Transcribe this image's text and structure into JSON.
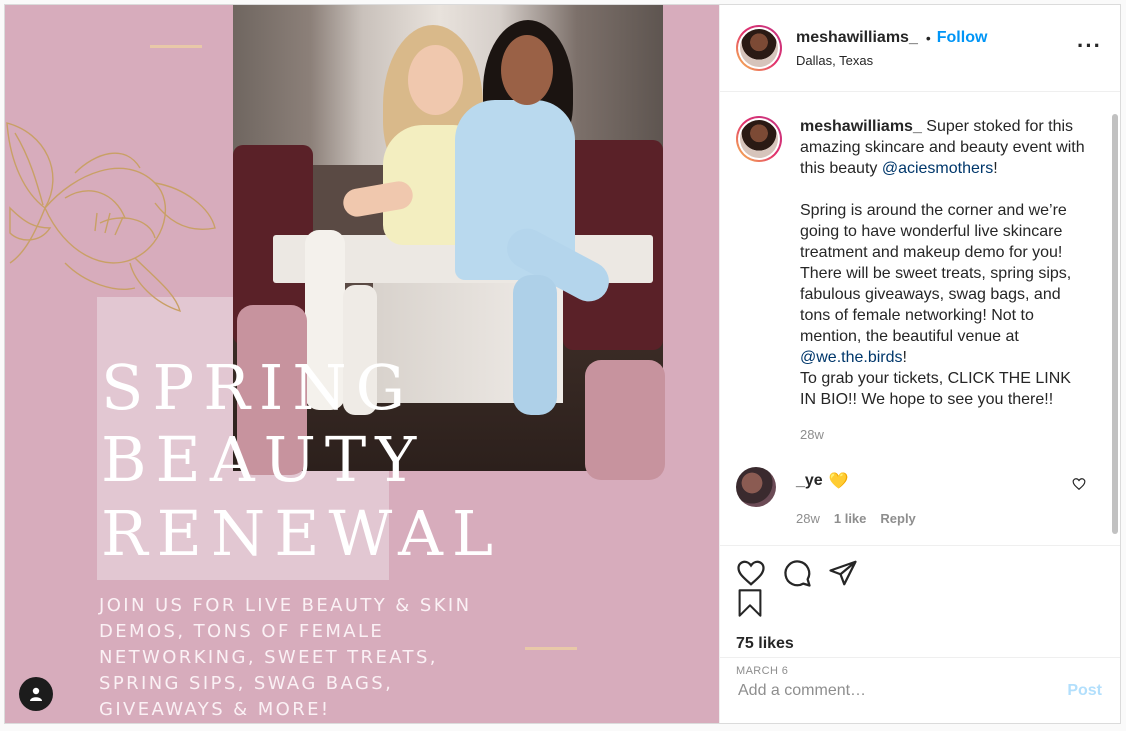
{
  "media": {
    "headline_lines": [
      "SPRING",
      "BEAUTY",
      "RENEWAL"
    ],
    "subtext": "JOIN US FOR LIVE BEAUTY & SKIN DEMOS, TONS OF FEMALE NETWORKING, SWEET TREATS, SPRING SIPS, SWAG BAGS, GIVEAWAYS & MORE!",
    "tag_icon": "user-icon",
    "colors": {
      "background": "#d7acbc",
      "panel": "#e2c7d2",
      "gold": "#c9a066"
    }
  },
  "header": {
    "username": "meshawilliams_",
    "separator": "•",
    "follow_label": "Follow",
    "location": "Dallas, Texas",
    "more_icon": "more-options-icon"
  },
  "caption": {
    "username": "meshawilliams_",
    "p1_text": " Super stoked for this amazing skincare and beauty event with this beauty ",
    "p1_mention": "@aciesmothers",
    "p1_end": "!",
    "p2_text": "Spring is around the corner and we’re going to have wonderful live skincare treatment and makeup demo for you! There will be sweet treats, spring sips, fabulous giveaways, swag bags, and tons of female networking! Not to mention, the beautiful venue at ",
    "p2_mention": "@we.the.birds",
    "p2_end": "!",
    "p3_text": "To grab your tickets, CLICK THE LINK IN BIO!! We hope to see you there!!",
    "time": "28w"
  },
  "reply": {
    "username": "_ye",
    "emoji": "💛",
    "time": "28w",
    "likes": "1 like",
    "reply_label": "Reply"
  },
  "actions": {
    "like_icon": "heart-icon",
    "comment_icon": "comment-icon",
    "share_icon": "share-icon",
    "save_icon": "bookmark-icon",
    "likes": "75 likes",
    "date": "MARCH 6"
  },
  "add_comment": {
    "placeholder": "Add a comment…",
    "post_label": "Post",
    "post_color": "#b2dffc"
  }
}
